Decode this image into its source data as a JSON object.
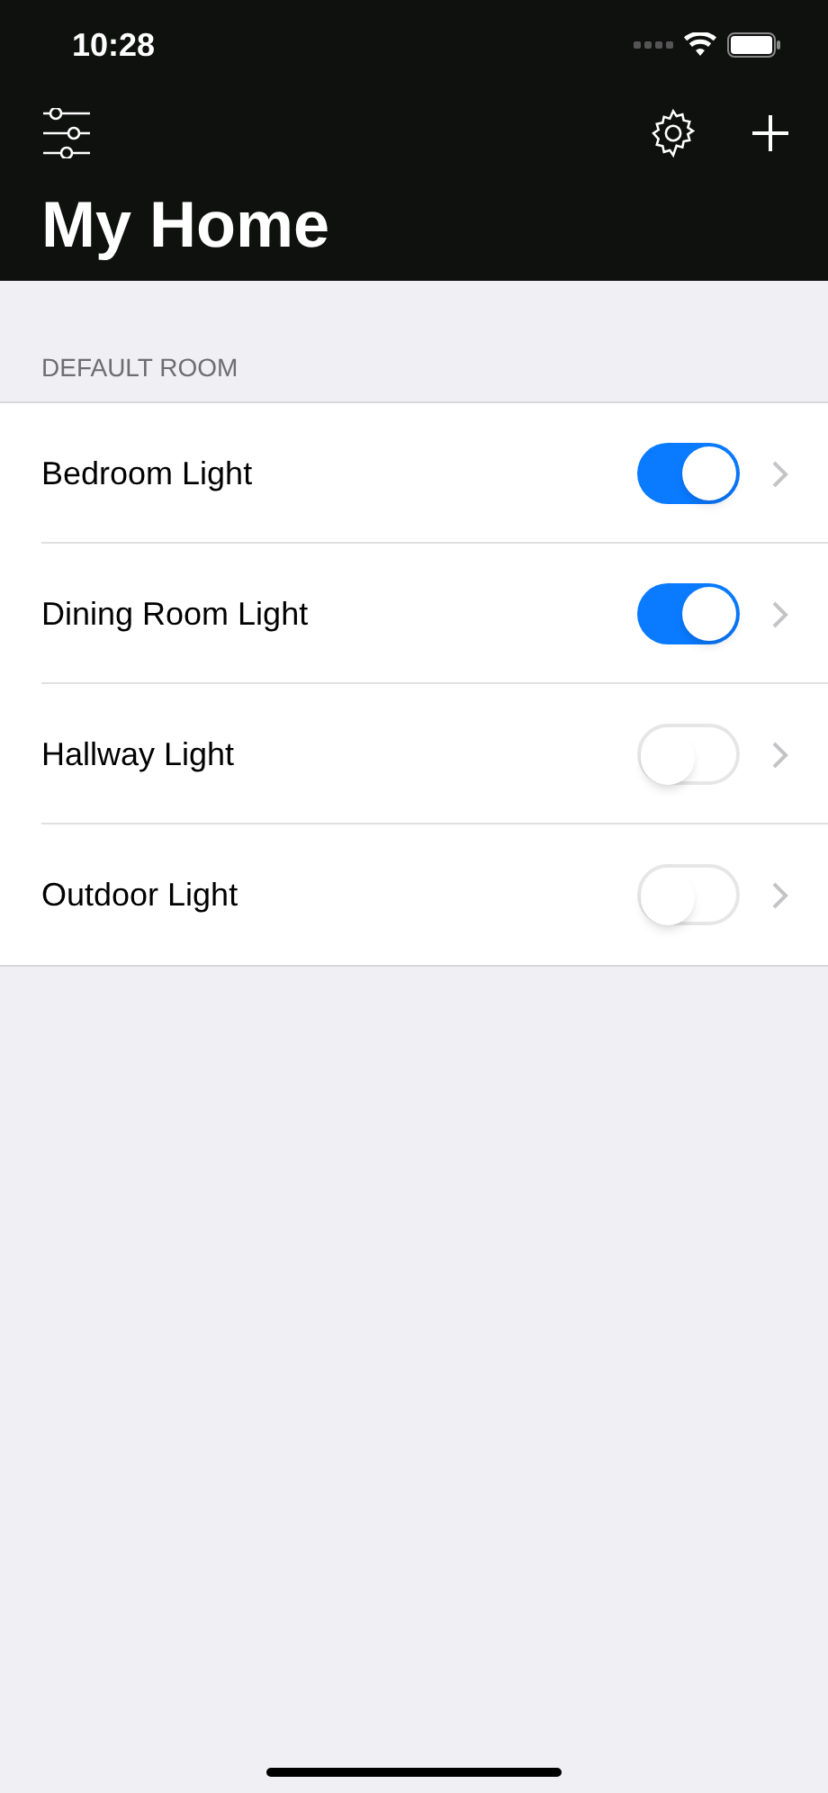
{
  "status_bar": {
    "time": "10:28"
  },
  "header": {
    "title": "My Home"
  },
  "section": {
    "title": "DEFAULT ROOM",
    "items": [
      {
        "label": "Bedroom Light",
        "on": true
      },
      {
        "label": "Dining Room Light",
        "on": true
      },
      {
        "label": "Hallway Light",
        "on": false
      },
      {
        "label": "Outdoor Light",
        "on": false
      }
    ]
  }
}
